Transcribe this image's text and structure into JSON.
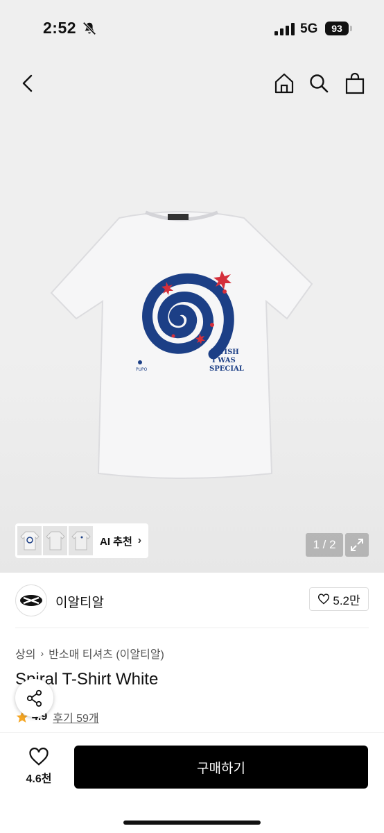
{
  "status_bar": {
    "time": "2:52",
    "network": "5G",
    "battery": "93"
  },
  "header": {
    "icons": [
      "back-icon",
      "home-icon",
      "search-icon",
      "shopping-bag-icon"
    ]
  },
  "gallery": {
    "shirt_print_text": [
      "I WISH",
      "I WAS",
      "SPECIAL"
    ],
    "shirt_small_text": "PUPO",
    "ai_button_label": "AI 추천",
    "page_counter": "1 / 2"
  },
  "brand": {
    "name": "이알티알",
    "likes": "5.2만"
  },
  "breadcrumb": {
    "category": "상의",
    "subcategory": "반소매 티셔츠 (이알티알)"
  },
  "product": {
    "title": "Spiral T-Shirt White",
    "rating": "4.9",
    "reviews": "후기 59개"
  },
  "bottom_bar": {
    "wishlist_count": "4.6천",
    "buy_label": "구매하기"
  },
  "colors": {
    "accent": "#000000",
    "star": "#f5a623",
    "print_navy": "#1c3f86",
    "print_red": "#d42f3b"
  }
}
